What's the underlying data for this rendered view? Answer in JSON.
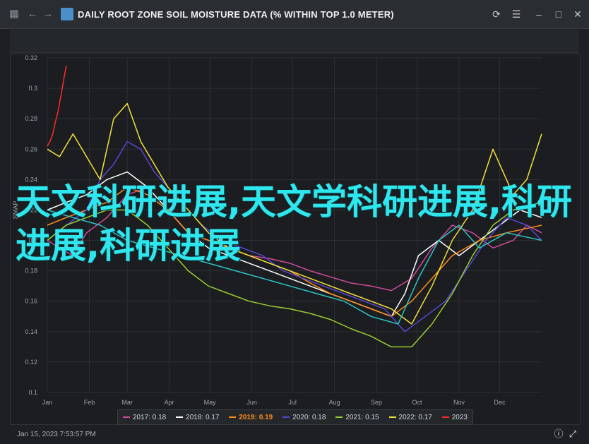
{
  "window": {
    "title": "DAILY ROOT ZONE SOIL MOISTURE DATA (% WITHIN TOP 1.0 METER)",
    "nav_icons": [
      "menu-grid-icon",
      "back-arrow-icon",
      "forward-arrow-icon"
    ],
    "actions": [
      "refresh-icon",
      "hamburger-menu-icon",
      "minimize-icon",
      "maximize-icon",
      "close-icon"
    ]
  },
  "overlay_text": "天文科研进展,天文学科研进展,科研进展,科研进展",
  "footer": {
    "timestamp": "Jan 15, 2023 7:53:57 PM"
  },
  "colors": {
    "2017": "#d04a9b",
    "2018": "#ffffff",
    "2019": "#ff8c1a",
    "2020": "#5a46d6",
    "2021": "#9acd32",
    "2022": "#f2e13a",
    "2023": "#ff2a2a",
    "teal": "#2ec4c4"
  },
  "chart_data": {
    "type": "line",
    "ylabel": "SMAP",
    "yticks": [
      0.1,
      0.12,
      0.14,
      0.16,
      0.18,
      0.2,
      0.22,
      0.24,
      0.26,
      0.28,
      0.3,
      0.32
    ],
    "ylim": [
      0.1,
      0.32
    ],
    "xticks": [
      "Jan",
      "Feb",
      "Mar",
      "Apr",
      "May",
      "Jun",
      "Jul",
      "Aug",
      "Sep",
      "Oct",
      "Nov",
      "Dec"
    ],
    "xlim": [
      1,
      366
    ],
    "grid": true,
    "legend_position": "bottom",
    "series": [
      {
        "name": "2017",
        "legend": "2017: 0.18",
        "x": [
          1,
          10,
          20,
          30,
          45,
          60,
          75,
          90,
          105,
          120,
          135,
          150,
          165,
          180,
          195,
          210,
          225,
          240,
          255,
          270,
          285,
          300,
          315,
          330,
          345,
          355,
          366
        ],
        "y": [
          0.2,
          0.195,
          0.19,
          0.205,
          0.215,
          0.23,
          0.235,
          0.22,
          0.205,
          0.2,
          0.195,
          0.19,
          0.188,
          0.185,
          0.18,
          0.176,
          0.172,
          0.17,
          0.167,
          0.175,
          0.195,
          0.21,
          0.205,
          0.195,
          0.2,
          0.21,
          0.205
        ]
      },
      {
        "name": "2018",
        "legend": "2018: 0.17",
        "x": [
          1,
          15,
          30,
          45,
          60,
          75,
          90,
          105,
          120,
          135,
          150,
          165,
          180,
          195,
          210,
          225,
          240,
          255,
          265,
          275,
          290,
          305,
          320,
          335,
          350,
          366
        ],
        "y": [
          0.22,
          0.225,
          0.23,
          0.24,
          0.245,
          0.235,
          0.22,
          0.205,
          0.195,
          0.19,
          0.185,
          0.18,
          0.175,
          0.17,
          0.165,
          0.16,
          0.155,
          0.15,
          0.165,
          0.19,
          0.2,
          0.19,
          0.2,
          0.21,
          0.22,
          0.215
        ]
      },
      {
        "name": "2019",
        "legend": "2019: 0.19",
        "x": [
          1,
          15,
          30,
          45,
          60,
          75,
          90,
          105,
          120,
          135,
          150,
          165,
          180,
          195,
          210,
          225,
          240,
          255,
          270,
          285,
          300,
          320,
          340,
          366
        ],
        "y": [
          0.21,
          0.215,
          0.22,
          0.225,
          0.235,
          0.23,
          0.22,
          0.205,
          0.2,
          0.195,
          0.19,
          0.185,
          0.18,
          0.172,
          0.165,
          0.16,
          0.155,
          0.15,
          0.16,
          0.175,
          0.19,
          0.2,
          0.205,
          0.21
        ]
      },
      {
        "name": "2020",
        "legend": "2020: 0.18",
        "x": [
          1,
          15,
          30,
          40,
          50,
          60,
          70,
          80,
          90,
          100,
          115,
          130,
          145,
          160,
          175,
          190,
          205,
          220,
          235,
          250,
          265,
          280,
          295,
          310,
          325,
          340,
          355,
          366
        ],
        "y": [
          0.2,
          0.21,
          0.22,
          0.24,
          0.25,
          0.265,
          0.26,
          0.245,
          0.235,
          0.225,
          0.21,
          0.2,
          0.195,
          0.19,
          0.18,
          0.175,
          0.17,
          0.165,
          0.16,
          0.155,
          0.14,
          0.15,
          0.16,
          0.18,
          0.2,
          0.215,
          0.21,
          0.2
        ]
      },
      {
        "name": "2021",
        "legend": "2021: 0.15",
        "x": [
          1,
          15,
          30,
          45,
          60,
          75,
          90,
          105,
          120,
          135,
          150,
          165,
          180,
          195,
          210,
          225,
          240,
          255,
          270,
          285,
          300,
          315,
          330,
          345,
          366
        ],
        "y": [
          0.2,
          0.21,
          0.215,
          0.22,
          0.22,
          0.21,
          0.195,
          0.18,
          0.17,
          0.165,
          0.16,
          0.157,
          0.155,
          0.152,
          0.148,
          0.142,
          0.137,
          0.13,
          0.13,
          0.145,
          0.165,
          0.19,
          0.21,
          0.22,
          0.225
        ]
      },
      {
        "name": "2022",
        "legend": "2022: 0.17",
        "x": [
          1,
          10,
          20,
          30,
          40,
          50,
          60,
          70,
          80,
          90,
          105,
          120,
          135,
          150,
          165,
          180,
          195,
          210,
          225,
          240,
          255,
          270,
          285,
          300,
          315,
          330,
          345,
          355,
          366
        ],
        "y": [
          0.26,
          0.255,
          0.27,
          0.255,
          0.24,
          0.28,
          0.29,
          0.265,
          0.25,
          0.235,
          0.22,
          0.205,
          0.195,
          0.19,
          0.185,
          0.18,
          0.175,
          0.17,
          0.165,
          0.16,
          0.155,
          0.145,
          0.17,
          0.2,
          0.22,
          0.26,
          0.23,
          0.24,
          0.27
        ]
      },
      {
        "name": "2023",
        "legend": "2023",
        "x": [
          1,
          3,
          5,
          7,
          9,
          11,
          13,
          15
        ],
        "y": [
          0.262,
          0.265,
          0.27,
          0.278,
          0.285,
          0.295,
          0.305,
          0.315
        ]
      },
      {
        "name": "",
        "x": [
          1,
          20,
          40,
          60,
          80,
          100,
          120,
          140,
          160,
          180,
          200,
          220,
          240,
          260,
          275,
          290,
          305,
          320,
          340,
          366
        ],
        "y": [
          0.22,
          0.215,
          0.21,
          0.2,
          0.195,
          0.19,
          0.185,
          0.18,
          0.175,
          0.17,
          0.165,
          0.16,
          0.15,
          0.145,
          0.175,
          0.2,
          0.21,
          0.195,
          0.205,
          0.2
        ]
      }
    ]
  }
}
